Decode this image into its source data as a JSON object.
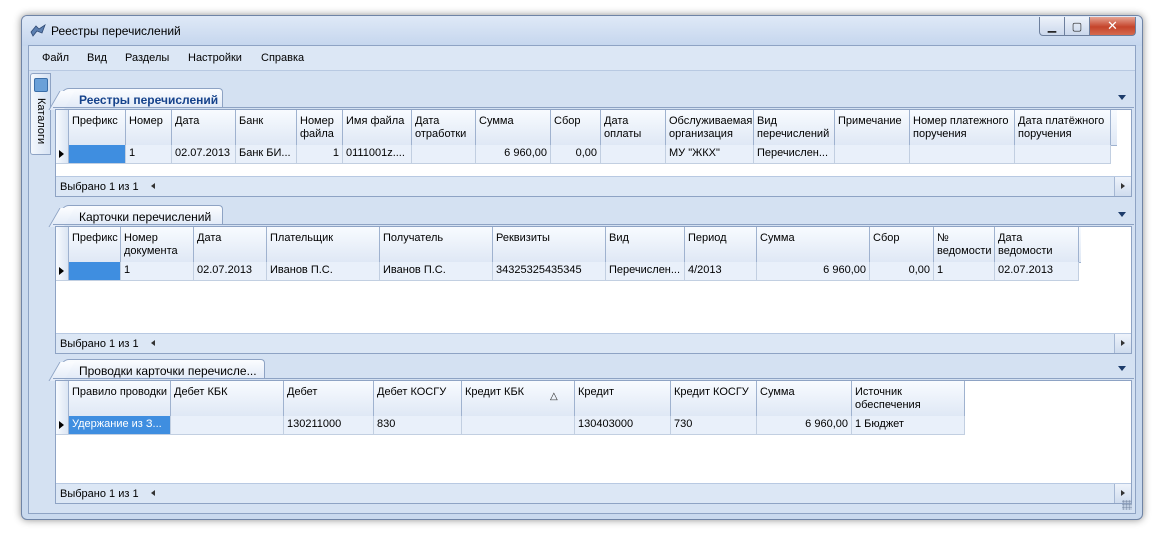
{
  "window": {
    "title": "Реестры перечислений"
  },
  "menu": [
    "Файл",
    "Вид",
    "Разделы",
    "Настройки",
    "Справка"
  ],
  "side_tab": {
    "label": "Каталоги"
  },
  "panels": {
    "registries": {
      "tab_label": "Реестры перечислений",
      "columns": [
        "Префикс",
        "Номер",
        "Дата",
        "Банк",
        "Номер файла",
        "Имя файла",
        "Дата отработки",
        "Сумма",
        "Сбор",
        "Дата оплаты",
        "Обслуживаемая организация",
        "Вид перечислений",
        "Примечание",
        "Номер платежного поручения",
        "Дата платёжного поручения"
      ],
      "row": [
        "",
        "1",
        "02.07.2013",
        "Банк БИ...",
        "1",
        "0111001z....",
        "",
        "6 960,00",
        "0,00",
        "",
        "МУ \"ЖКХ\"",
        "Перечислен...",
        "",
        "",
        ""
      ],
      "footer": "Выбрано 1 из 1"
    },
    "cards": {
      "tab_label": "Карточки перечислений",
      "columns": [
        "Префикс",
        "Номер документа",
        "Дата",
        "Плательщик",
        "Получатель",
        "Реквизиты",
        "Вид",
        "Период",
        "Сумма",
        "Сбор",
        "№ ведомости",
        "Дата ведомости"
      ],
      "row": [
        "",
        "1",
        "02.07.2013",
        "Иванов П.С.",
        "Иванов П.С.",
        "34325325435345",
        "Перечислен...",
        "4/2013",
        "6 960,00",
        "0,00",
        "1",
        "02.07.2013"
      ],
      "footer": "Выбрано 1 из 1"
    },
    "entries": {
      "tab_label": "Проводки карточки перечисле...",
      "columns": [
        "Правило проводки",
        "Дебет КБК",
        "Дебет",
        "Дебет КОСГУ",
        "Кредит КБК",
        "Кредит",
        "Кредит КОСГУ",
        "Сумма",
        "Источник обеспечения"
      ],
      "row": [
        "Удержание из З...",
        "",
        "130211000",
        "830",
        "",
        "130403000",
        "730",
        "6 960,00",
        "1 Бюджет"
      ],
      "footer": "Выбрано 1 из 1"
    }
  },
  "icons": {
    "sort": "sort-ascending-icon",
    "collapse": "chevron-down-icon"
  }
}
